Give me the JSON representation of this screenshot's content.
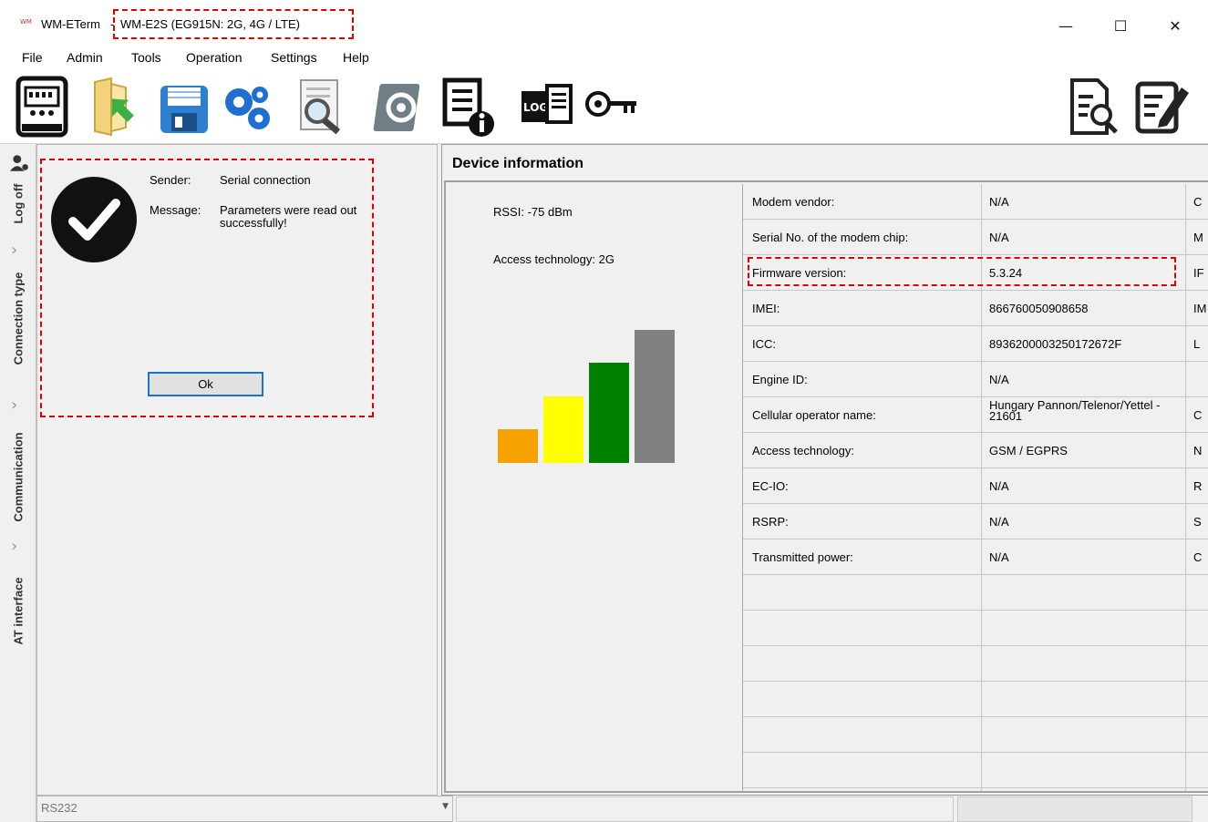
{
  "window": {
    "app_name": "WM-ETerm",
    "separator": "-",
    "device_title": "WM-E2S (EG915N: 2G, 4G / LTE)",
    "logo_text": "WM",
    "minimize": "—",
    "maximize": "☐",
    "close": "✕"
  },
  "menu": [
    "File",
    "Admin",
    "Tools",
    "Operation",
    "Settings",
    "Help"
  ],
  "toolbar": {
    "icons": [
      "meter-icon",
      "folder-open-icon",
      "save-icon",
      "gears-icon",
      "search-document-icon",
      "firmware-gear-icon",
      "device-info-icon",
      "log-icon",
      "key-icon",
      "report-icon",
      "edit-icon"
    ],
    "log_text": "LOG"
  },
  "sidebar": {
    "tabs": [
      {
        "label": "Log off"
      },
      {
        "label": "Connection type"
      },
      {
        "label": "Communication"
      },
      {
        "label": "AT interface"
      }
    ],
    "chevron": "›"
  },
  "dialog": {
    "sender_label": "Sender:",
    "sender_value": "Serial connection",
    "message_label": "Message:",
    "message_line1": "Parameters were read out",
    "message_line2": "successfully!",
    "ok_label": "Ok"
  },
  "status": {
    "port": "RS232",
    "arrow": "▼"
  },
  "device_info": {
    "title": "Device information",
    "rssi": "RSSI: -75 dBm",
    "access_technology": "Access technology: 2G",
    "signal_bars": [
      {
        "color": "#f5a100",
        "level": 0.25
      },
      {
        "color": "#ffff00",
        "level": 0.5
      },
      {
        "color": "#008000",
        "level": 0.75
      },
      {
        "color": "#808080",
        "level": 1.0
      }
    ],
    "rows": [
      {
        "name": "Modem vendor:",
        "value": "N/A",
        "extra": "C"
      },
      {
        "name": "Serial No. of the modem chip:",
        "value": "N/A",
        "extra": "M"
      },
      {
        "name": "Firmware version:",
        "value": "5.3.24",
        "extra": "IF"
      },
      {
        "name": "IMEI:",
        "value": "866760050908658",
        "extra": "IM"
      },
      {
        "name": "ICC:",
        "value": "8936200003250172672F",
        "extra": "L"
      },
      {
        "name": "Engine ID:",
        "value": "N/A",
        "extra": ""
      },
      {
        "name": "Cellular operator name:",
        "value": "Hungary Pannon/Telenor/Yettel - 21601",
        "extra": "C"
      },
      {
        "name": "Access technology:",
        "value": "GSM / EGPRS",
        "extra": "N"
      },
      {
        "name": "EC-IO:",
        "value": "N/A",
        "extra": "R"
      },
      {
        "name": "RSRP:",
        "value": "N/A",
        "extra": "S"
      },
      {
        "name": "Transmitted power:",
        "value": "N/A",
        "extra": "C"
      }
    ]
  }
}
